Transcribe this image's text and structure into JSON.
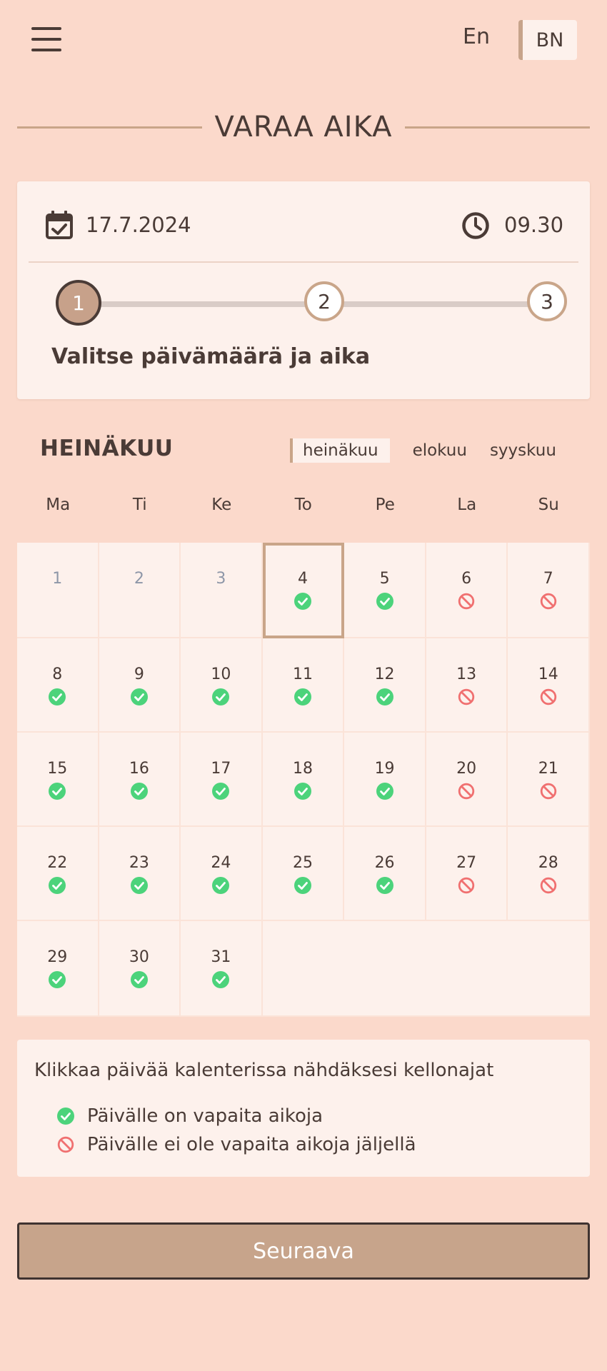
{
  "header": {
    "lang_en": "En",
    "lang_bn": "BN"
  },
  "page_title": "VARAA AIKA",
  "summary": {
    "date": "17.7.2024",
    "time": "09.30",
    "steps": [
      "1",
      "2",
      "3"
    ],
    "active_step": 1,
    "hint": "Valitse päivämäärä ja aika"
  },
  "calendar": {
    "month_name": "HEINÄKUU",
    "month_tabs": [
      "heinäkuu",
      "elokuu",
      "syyskuu"
    ],
    "active_month_tab": 0,
    "weekdays": [
      "Ma",
      "Ti",
      "Ke",
      "To",
      "Pe",
      "La",
      "Su"
    ],
    "selected_day": "4",
    "days": [
      {
        "n": "1",
        "status": "past"
      },
      {
        "n": "2",
        "status": "past"
      },
      {
        "n": "3",
        "status": "past"
      },
      {
        "n": "4",
        "status": "available"
      },
      {
        "n": "5",
        "status": "available"
      },
      {
        "n": "6",
        "status": "full"
      },
      {
        "n": "7",
        "status": "full"
      },
      {
        "n": "8",
        "status": "available"
      },
      {
        "n": "9",
        "status": "available"
      },
      {
        "n": "10",
        "status": "available"
      },
      {
        "n": "11",
        "status": "available"
      },
      {
        "n": "12",
        "status": "available"
      },
      {
        "n": "13",
        "status": "full"
      },
      {
        "n": "14",
        "status": "full"
      },
      {
        "n": "15",
        "status": "available"
      },
      {
        "n": "16",
        "status": "available"
      },
      {
        "n": "17",
        "status": "available"
      },
      {
        "n": "18",
        "status": "available"
      },
      {
        "n": "19",
        "status": "available"
      },
      {
        "n": "20",
        "status": "full"
      },
      {
        "n": "21",
        "status": "full"
      },
      {
        "n": "22",
        "status": "available"
      },
      {
        "n": "23",
        "status": "available"
      },
      {
        "n": "24",
        "status": "available"
      },
      {
        "n": "25",
        "status": "available"
      },
      {
        "n": "26",
        "status": "available"
      },
      {
        "n": "27",
        "status": "full"
      },
      {
        "n": "28",
        "status": "full"
      },
      {
        "n": "29",
        "status": "available"
      },
      {
        "n": "30",
        "status": "available"
      },
      {
        "n": "31",
        "status": "available"
      }
    ]
  },
  "legend": {
    "hint": "Klikkaa päivää kalenterissa nähdäksesi kellonajat",
    "available": "Päivälle on vapaita aikoja",
    "full": "Päivälle ei ole vapaita aikoja jäljellä"
  },
  "next_button": "Seuraava",
  "colors": {
    "background": "#fbd9cb",
    "accent": "#c7a48b",
    "available": "#4cd37b",
    "full": "#f07070",
    "text": "#4a3b36"
  },
  "icons": {
    "menu": "hamburger-icon",
    "date": "calendar-check-icon",
    "time": "clock-icon",
    "available": "check-circle-icon",
    "full": "ban-icon"
  }
}
